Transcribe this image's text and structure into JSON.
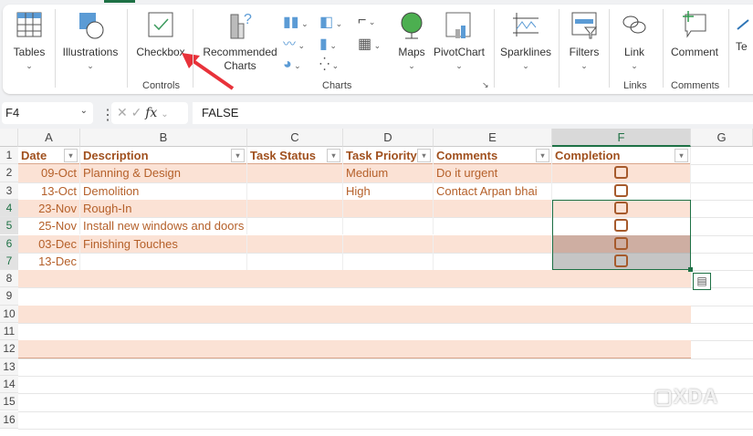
{
  "ribbon": {
    "buttons": {
      "tables": "Tables",
      "illustrations": "Illustrations",
      "checkbox": "Checkbox",
      "recommended_charts": "Recommended Charts",
      "maps": "Maps",
      "pivotchart": "PivotChart",
      "sparklines": "Sparklines",
      "filters": "Filters",
      "link": "Link",
      "comment": "Comment",
      "text": "Te"
    },
    "groups": {
      "controls": "Controls",
      "charts": "Charts",
      "links": "Links",
      "comments": "Comments"
    }
  },
  "formula_bar": {
    "name_box": "F4",
    "fx": "fx",
    "value": "FALSE"
  },
  "columns": [
    "A",
    "B",
    "C",
    "D",
    "E",
    "F",
    "G"
  ],
  "rows": [
    "1",
    "2",
    "3",
    "4",
    "5",
    "6",
    "7",
    "8",
    "9",
    "10",
    "11",
    "12",
    "13",
    "14",
    "15",
    "16"
  ],
  "table": {
    "headers": [
      "Date",
      "Description",
      "Task Status",
      "Task Priority",
      "Comments",
      "Completion"
    ],
    "data": [
      [
        "09-Oct",
        "Planning & Design",
        "",
        "Medium",
        "Do it urgent",
        false
      ],
      [
        "13-Oct",
        "Demolition",
        "",
        "High",
        "Contact Arpan bhai",
        false
      ],
      [
        "23-Nov",
        "Rough-In",
        "",
        "",
        "",
        false
      ],
      [
        "25-Nov",
        "Install new windows and doors",
        "",
        "",
        "",
        false
      ],
      [
        "03-Dec",
        "Finishing Touches",
        "",
        "",
        "",
        false
      ],
      [
        "13-Dec",
        "",
        "",
        "",
        "",
        false
      ]
    ]
  },
  "watermark": "XDA",
  "colors": {
    "band": "#fbe2d5",
    "text": "#b5602a",
    "select": "#1e7145",
    "arrow": "#e8323a"
  }
}
